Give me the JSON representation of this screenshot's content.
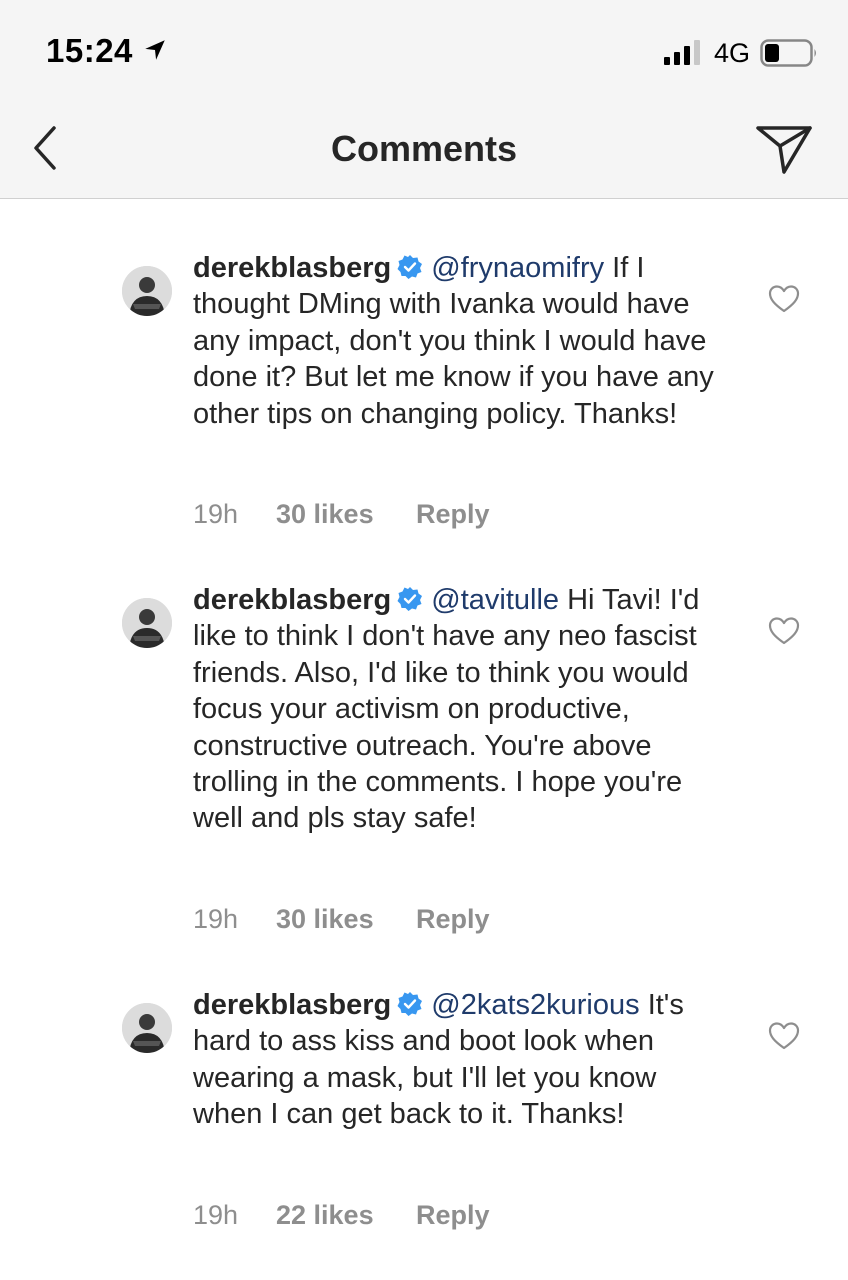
{
  "status_bar": {
    "time": "15:24",
    "network": "4G",
    "icons": [
      "location-arrow-icon",
      "signal-icon",
      "battery-icon"
    ]
  },
  "header": {
    "title": "Comments",
    "back_icon": "chevron-left-icon",
    "share_icon": "paper-plane-icon"
  },
  "colors": {
    "mention": "#1f3b6b",
    "verified": "#3897f0",
    "meta": "#8e8e8e"
  },
  "comments": [
    {
      "username": "derekblasberg",
      "verified": true,
      "mention": "@frynaomifry",
      "text": " If I thought DMing with Ivanka would have any impact, don't you think I would have done it? But let me know if you have any other tips on changing policy. Thanks!",
      "time": "19h",
      "likes": "30 likes",
      "reply": "Reply"
    },
    {
      "username": "derekblasberg",
      "verified": true,
      "mention": "@tavitulle",
      "text": " Hi Tavi! I'd like to think I don't have any neo fascist friends. Also, I'd like to think you would focus your activism on productive, constructive outreach. You're above trolling in the comments. I hope you're well and pls stay safe!",
      "time": "19h",
      "likes": "30 likes",
      "reply": "Reply"
    },
    {
      "username": "derekblasberg",
      "verified": true,
      "mention": "@2kats2kurious",
      "text": " It's hard to ass kiss and boot look when wearing a mask, but I'll let you know when I can get back to it. Thanks!",
      "time": "19h",
      "likes": "22 likes",
      "reply": "Reply"
    }
  ]
}
